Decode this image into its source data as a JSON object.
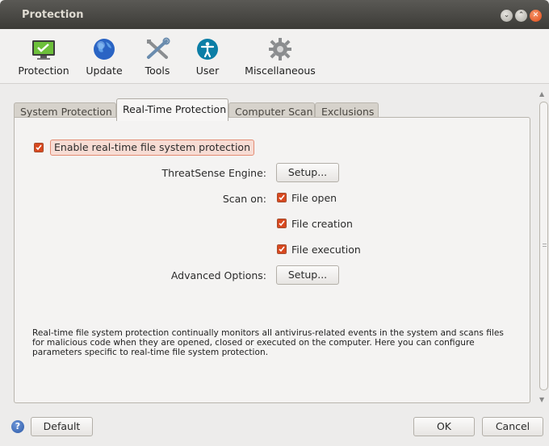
{
  "window": {
    "title": "Protection"
  },
  "toolbar": {
    "items": [
      {
        "label": "Protection",
        "icon": "monitor-check-icon"
      },
      {
        "label": "Update",
        "icon": "globe-icon"
      },
      {
        "label": "Tools",
        "icon": "tools-icon"
      },
      {
        "label": "User",
        "icon": "user-accessibility-icon"
      },
      {
        "label": "Miscellaneous",
        "icon": "gear-icon"
      }
    ]
  },
  "tabs": [
    {
      "label": "System Protection",
      "active": false
    },
    {
      "label": "Real-Time Protection",
      "active": true
    },
    {
      "label": "Computer Scan",
      "active": false
    },
    {
      "label": "Exclusions",
      "active": false
    }
  ],
  "realtime": {
    "enable_label": "Enable real-time file system protection",
    "enable_checked": true,
    "threatsense_label": "ThreatSense Engine:",
    "setup_label": "Setup...",
    "scan_on_label": "Scan on:",
    "scan_options": [
      {
        "label": "File open",
        "checked": true
      },
      {
        "label": "File creation",
        "checked": true
      },
      {
        "label": "File execution",
        "checked": true
      }
    ],
    "advanced_label": "Advanced Options:",
    "advanced_setup_label": "Setup...",
    "description": "Real-time file system protection continually monitors all antivirus-related events in the system and scans files for malicious code when they are opened, closed or executed on the computer. Here you can configure parameters specific to real-time file system protection."
  },
  "footer": {
    "help_icon": "help-icon",
    "default_label": "Default",
    "ok_label": "OK",
    "cancel_label": "Cancel"
  },
  "colors": {
    "accent": "#d8481f",
    "titlebar": "#3c3b37",
    "close_button": "#df4a16"
  }
}
